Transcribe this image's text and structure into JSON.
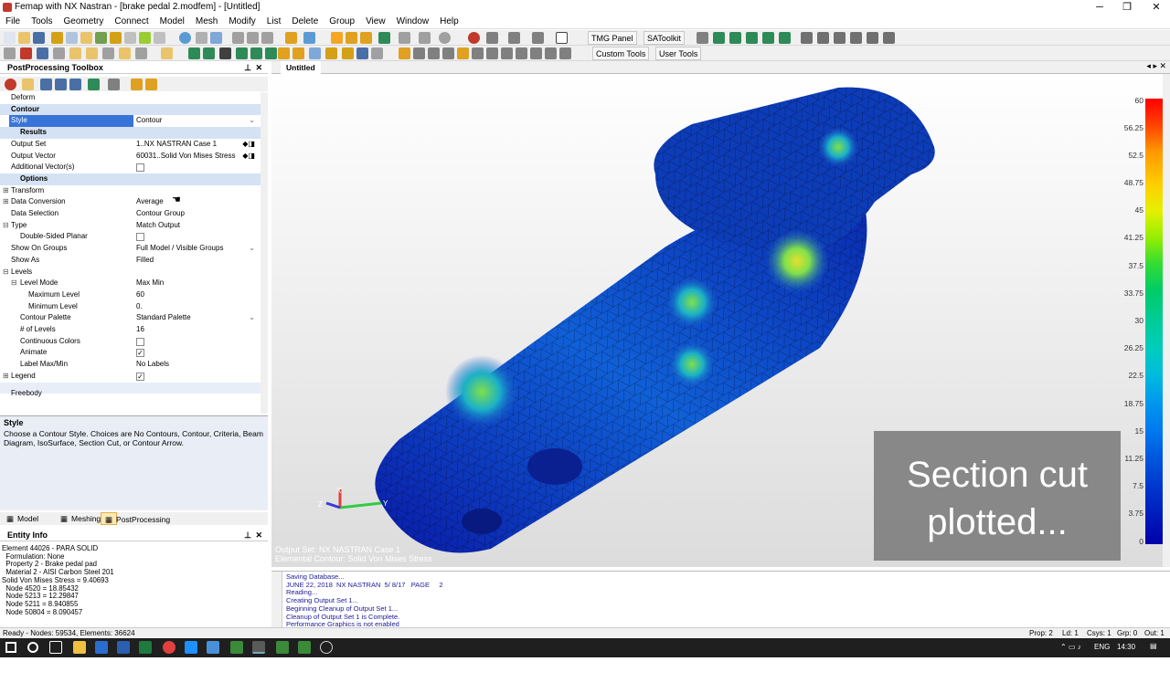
{
  "window": {
    "title": "Femap with NX Nastran - [brake pedal 2.modfem] - [Untitled]"
  },
  "menu": [
    "File",
    "Tools",
    "Geometry",
    "Connect",
    "Model",
    "Mesh",
    "Modify",
    "List",
    "Delete",
    "Group",
    "View",
    "Window",
    "Help"
  ],
  "toolbar": {
    "tmg": "TMG Panel",
    "satoolkit": "SAToolkit",
    "custom_tools": "Custom Tools",
    "user_tools": "User Tools"
  },
  "postproc": {
    "title": "PostProcessing Toolbox",
    "deform": "Deform",
    "contour": "Contour",
    "style_k": "Style",
    "style_v": "Contour",
    "results": "Results",
    "output_set_k": "Output Set",
    "output_set_v": "1..NX NASTRAN Case 1",
    "output_vector_k": "Output Vector",
    "output_vector_v": "60031..Solid Von Mises Stress",
    "additional_k": "Additional Vector(s)",
    "options": "Options",
    "transform_k": "Transform",
    "data_conv_k": "Data Conversion",
    "data_conv_v": "Average",
    "data_sel_k": "Data Selection",
    "data_sel_v": "Contour Group",
    "type_k": "Type",
    "type_v": "Match Output",
    "double_k": "Double-Sided Planar",
    "show_groups_k": "Show On Groups",
    "show_groups_v": "Full Model / Visible Groups",
    "show_as_k": "Show As",
    "show_as_v": "Filled",
    "levels_k": "Levels",
    "level_mode_k": "Level Mode",
    "level_mode_v": "Max Min",
    "max_level_k": "Maximum Level",
    "max_level_v": "60",
    "min_level_k": "Minimum Level",
    "min_level_v": "0.",
    "palette_k": "Contour Palette",
    "palette_v": "Standard Palette",
    "num_levels_k": "# of Levels",
    "num_levels_v": "16",
    "continuous_k": "Continuous Colors",
    "animate_k": "Animate",
    "label_k": "Label Max/Min",
    "label_v": "No Labels",
    "legend_k": "Legend",
    "freebody": "Freebody",
    "desc_title": "Style",
    "desc_text": "Choose a Contour Style. Choices are No Contours, Contour, Criteria, Beam Diagram, IsoSurface, Section Cut, or Contour Arrow."
  },
  "tabs": {
    "model_info": "Model Info",
    "meshing": "Meshing",
    "postprocessing": "PostProcessing"
  },
  "entity_info": {
    "title": "Entity Info",
    "text": "Element 44026 - PARA SOLID\n  Formulation: None\n  Property 2 - Brake pedal pad\n  Material 2 - AISI Carbon Steel 201\nSolid Von Mises Stress = 9.40693\n  Node 4520 = 18.85432\n  Node 5213 = 12.29847\n  Node 5211 = 8.940855\n  Node 50804 = 8.090457"
  },
  "view": {
    "tab": "Untitled",
    "info": "Output Set: NX NASTRAN Case 1\nElemental Contour: Solid Von Mises Stress",
    "overlay": "Section cut plotted...",
    "legend": [
      "60",
      "56.25",
      "52.5",
      "48.75",
      "45",
      "41.25",
      "37.5",
      "33.75",
      "30",
      "26.25",
      "22.5",
      "18.75",
      "15",
      "11.25",
      "7.5",
      "3.75",
      "0"
    ],
    "axes": {
      "x": "X",
      "y": "Y",
      "z": "Z"
    }
  },
  "messages": "Saving Database...\nJUNE 22, 2018  NX NASTRAN  5/ 8/17   PAGE     2\nReading...\nCreating Output Set 1...\nBeginning Cleanup of Output Set 1...\nCleanup of Output Set 1 is Complete.\nPerformance Graphics is not enabled",
  "status": {
    "left": "Ready - Nodes: 59534, Elements: 36624",
    "prop": "Prop: 2",
    "ld": "Ld: 1",
    "csys": "Csys: 1",
    "grp": "Grp: 0",
    "out": "Out: 1"
  },
  "taskbar": {
    "lang": "ENG",
    "time": "14:30"
  },
  "colors": {
    "accent": "#3874d8",
    "legend_top": "#ff0000",
    "legend_bottom": "#0000aa"
  }
}
